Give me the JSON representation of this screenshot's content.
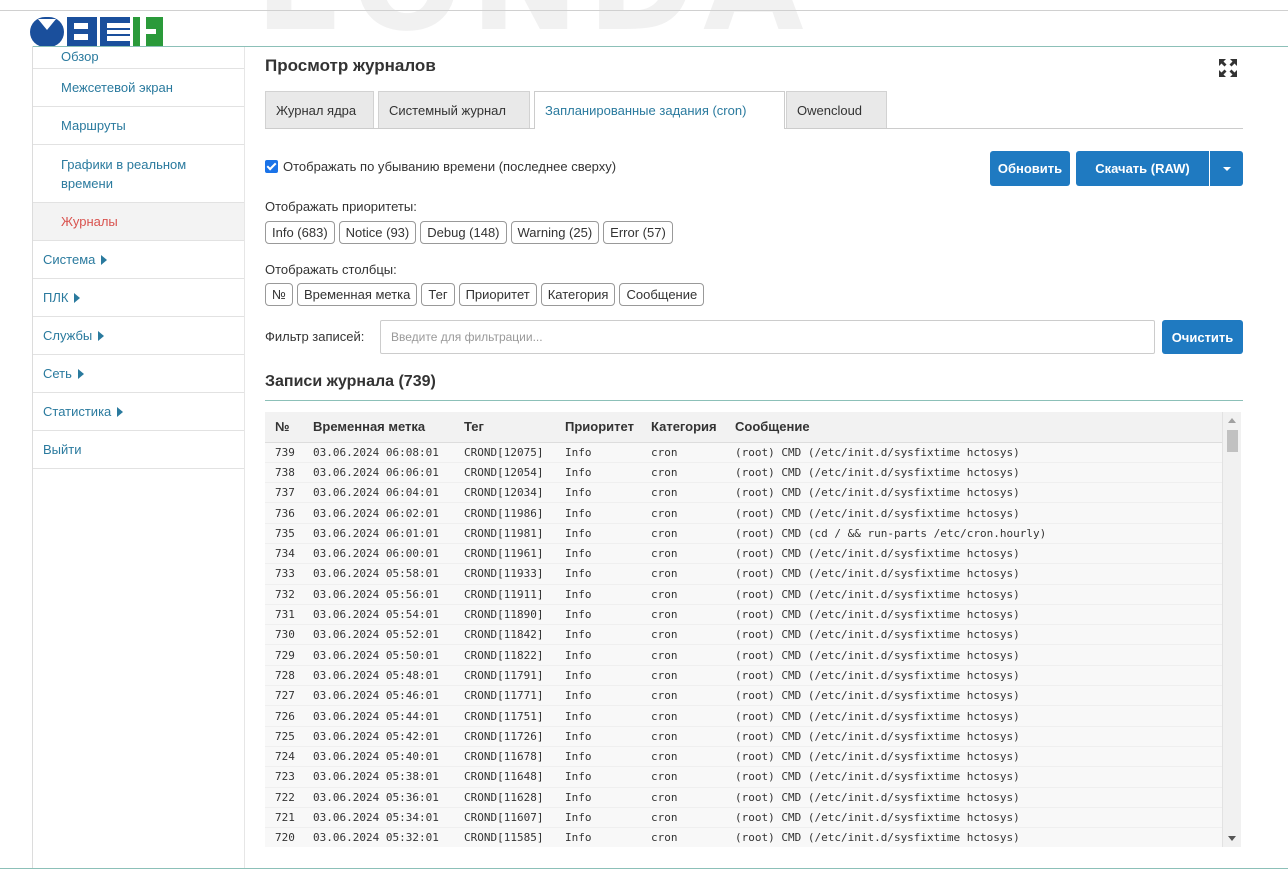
{
  "app": {
    "logo_text": "ОВЕН",
    "watermark": "ЕОNDA"
  },
  "sidebar": {
    "items": [
      {
        "label": "Обзор"
      },
      {
        "label": "Межсетевой экран"
      },
      {
        "label": "Маршруты"
      },
      {
        "label": "Графики в реальном времени"
      },
      {
        "label": "Журналы"
      },
      {
        "label": "Система"
      },
      {
        "label": "ПЛК"
      },
      {
        "label": "Службы"
      },
      {
        "label": "Сеть"
      },
      {
        "label": "Статистика"
      },
      {
        "label": "Выйти"
      }
    ]
  },
  "page": {
    "title": "Просмотр журналов"
  },
  "tabs": [
    {
      "label": "Журнал ядра"
    },
    {
      "label": "Системный журнал"
    },
    {
      "label": "Запланированные задания (cron)"
    },
    {
      "label": "Owencloud"
    }
  ],
  "options": {
    "sort_desc_label": "Отображать по убыванию времени (последнее сверху)",
    "sort_desc_checked": true
  },
  "buttons": {
    "refresh": "Обновить",
    "download": "Скачать (RAW)",
    "clear": "Очистить"
  },
  "priorities": {
    "label": "Отображать приоритеты:",
    "chips": [
      "Info (683)",
      "Notice (93)",
      "Debug (148)",
      "Warning (25)",
      "Error (57)"
    ]
  },
  "columns": {
    "label": "Отображать столбцы:",
    "chips": [
      "№",
      "Временная метка",
      "Тег",
      "Приоритет",
      "Категория",
      "Сообщение"
    ]
  },
  "filter": {
    "label": "Фильтр записей:",
    "placeholder": "Введите для фильтрации..."
  },
  "log": {
    "title": "Записи журнала (739)",
    "headers": [
      "№",
      "Временная метка",
      "Тег",
      "Приоритет",
      "Категория",
      "Сообщение"
    ],
    "rows": [
      [
        "739",
        "03.06.2024 06:08:01",
        "CROND[12075]",
        "Info",
        "cron",
        "(root) CMD (/etc/init.d/sysfixtime hctosys)"
      ],
      [
        "738",
        "03.06.2024 06:06:01",
        "CROND[12054]",
        "Info",
        "cron",
        "(root) CMD (/etc/init.d/sysfixtime hctosys)"
      ],
      [
        "737",
        "03.06.2024 06:04:01",
        "CROND[12034]",
        "Info",
        "cron",
        "(root) CMD (/etc/init.d/sysfixtime hctosys)"
      ],
      [
        "736",
        "03.06.2024 06:02:01",
        "CROND[11986]",
        "Info",
        "cron",
        "(root) CMD (/etc/init.d/sysfixtime hctosys)"
      ],
      [
        "735",
        "03.06.2024 06:01:01",
        "CROND[11981]",
        "Info",
        "cron",
        "(root) CMD (cd / && run-parts /etc/cron.hourly)"
      ],
      [
        "734",
        "03.06.2024 06:00:01",
        "CROND[11961]",
        "Info",
        "cron",
        "(root) CMD (/etc/init.d/sysfixtime hctosys)"
      ],
      [
        "733",
        "03.06.2024 05:58:01",
        "CROND[11933]",
        "Info",
        "cron",
        "(root) CMD (/etc/init.d/sysfixtime hctosys)"
      ],
      [
        "732",
        "03.06.2024 05:56:01",
        "CROND[11911]",
        "Info",
        "cron",
        "(root) CMD (/etc/init.d/sysfixtime hctosys)"
      ],
      [
        "731",
        "03.06.2024 05:54:01",
        "CROND[11890]",
        "Info",
        "cron",
        "(root) CMD (/etc/init.d/sysfixtime hctosys)"
      ],
      [
        "730",
        "03.06.2024 05:52:01",
        "CROND[11842]",
        "Info",
        "cron",
        "(root) CMD (/etc/init.d/sysfixtime hctosys)"
      ],
      [
        "729",
        "03.06.2024 05:50:01",
        "CROND[11822]",
        "Info",
        "cron",
        "(root) CMD (/etc/init.d/sysfixtime hctosys)"
      ],
      [
        "728",
        "03.06.2024 05:48:01",
        "CROND[11791]",
        "Info",
        "cron",
        "(root) CMD (/etc/init.d/sysfixtime hctosys)"
      ],
      [
        "727",
        "03.06.2024 05:46:01",
        "CROND[11771]",
        "Info",
        "cron",
        "(root) CMD (/etc/init.d/sysfixtime hctosys)"
      ],
      [
        "726",
        "03.06.2024 05:44:01",
        "CROND[11751]",
        "Info",
        "cron",
        "(root) CMD (/etc/init.d/sysfixtime hctosys)"
      ],
      [
        "725",
        "03.06.2024 05:42:01",
        "CROND[11726]",
        "Info",
        "cron",
        "(root) CMD (/etc/init.d/sysfixtime hctosys)"
      ],
      [
        "724",
        "03.06.2024 05:40:01",
        "CROND[11678]",
        "Info",
        "cron",
        "(root) CMD (/etc/init.d/sysfixtime hctosys)"
      ],
      [
        "723",
        "03.06.2024 05:38:01",
        "CROND[11648]",
        "Info",
        "cron",
        "(root) CMD (/etc/init.d/sysfixtime hctosys)"
      ],
      [
        "722",
        "03.06.2024 05:36:01",
        "CROND[11628]",
        "Info",
        "cron",
        "(root) CMD (/etc/init.d/sysfixtime hctosys)"
      ],
      [
        "721",
        "03.06.2024 05:34:01",
        "CROND[11607]",
        "Info",
        "cron",
        "(root) CMD (/etc/init.d/sysfixtime hctosys)"
      ],
      [
        "720",
        "03.06.2024 05:32:01",
        "CROND[11585]",
        "Info",
        "cron",
        "(root) CMD (/etc/init.d/sysfixtime hctosys)"
      ]
    ]
  },
  "colors": {
    "accent": "#1f7ac1",
    "active_nav": "#d9534f",
    "link": "#2a7a9e",
    "logo_blue": "#1a4f9c",
    "logo_green": "#2a9a3a",
    "divider_teal": "#8cc0b8"
  }
}
